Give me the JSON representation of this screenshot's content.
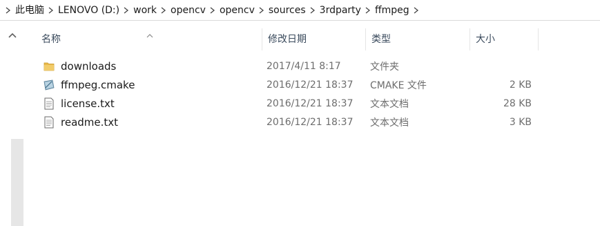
{
  "breadcrumb": {
    "items": [
      "此电脑",
      "LENOVO (D:)",
      "work",
      "opencv",
      "opencv",
      "sources",
      "3rdparty",
      "ffmpeg"
    ]
  },
  "columns": {
    "name": "名称",
    "date": "修改日期",
    "type": "类型",
    "size": "大小"
  },
  "sort": {
    "column": "name",
    "direction": "ascending"
  },
  "files": [
    {
      "name": "downloads",
      "date": "2017/4/11 8:17",
      "type": "文件夹",
      "size": "",
      "icon": "folder-icon"
    },
    {
      "name": "ffmpeg.cmake",
      "date": "2016/12/21 18:37",
      "type": "CMAKE 文件",
      "size": "2 KB",
      "icon": "cmake-file-icon"
    },
    {
      "name": "license.txt",
      "date": "2016/12/21 18:37",
      "type": "文本文档",
      "size": "28 KB",
      "icon": "text-file-icon"
    },
    {
      "name": "readme.txt",
      "date": "2016/12/21 18:37",
      "type": "文本文档",
      "size": "3 KB",
      "icon": "text-file-icon"
    }
  ],
  "colors": {
    "folder": "#e8b84a",
    "header_text": "#3a4a5c",
    "detail_text": "#6d6d6d",
    "separator": "#e5e5e5"
  }
}
